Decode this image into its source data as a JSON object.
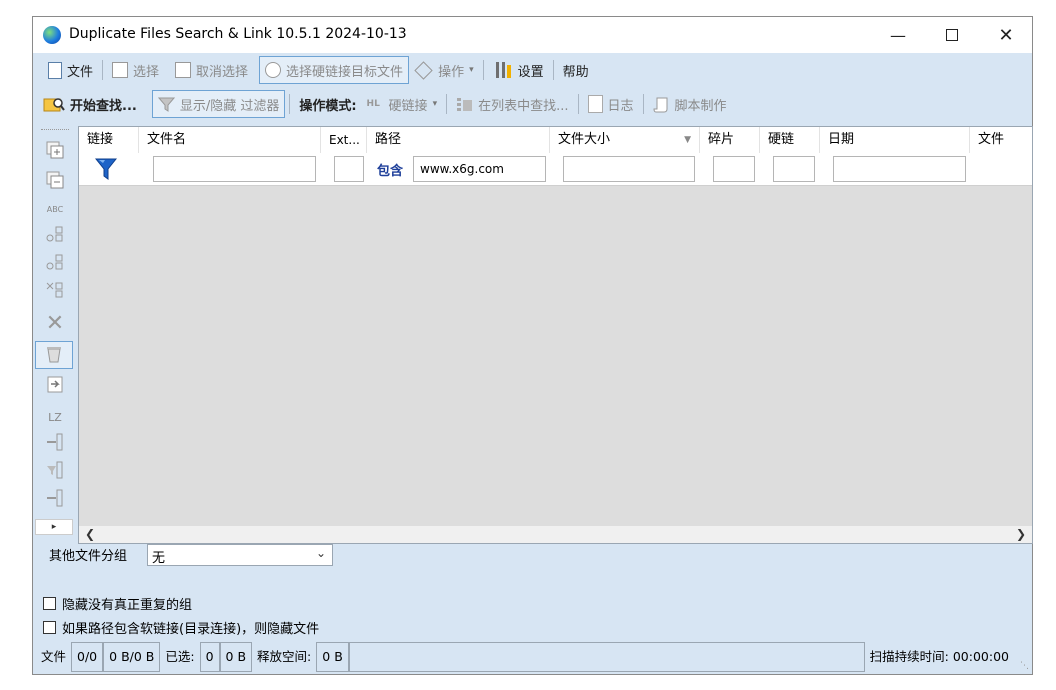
{
  "window": {
    "title": "Duplicate Files Search & Link 10.5.1 2024-10-13"
  },
  "toolbar1": {
    "file": "文件",
    "select": "选择",
    "deselect": "取消选择",
    "select_hardlink_target": "选择硬链接目标文件",
    "operation": "操作",
    "settings": "设置",
    "help": "帮助"
  },
  "toolbar2": {
    "start_search": "开始查找...",
    "toggle_filter": "显示/隐藏 过滤器",
    "mode_label": "操作模式:",
    "hardlink": "硬链接",
    "find_in_list": "在列表中查找...",
    "log": "日志",
    "script": "脚本制作"
  },
  "table": {
    "columns": [
      "链接",
      "文件名",
      "Ext...",
      "路径",
      "文件大小",
      "碎片",
      "硬链",
      "日期",
      "文件"
    ],
    "filter": {
      "path_mode": "包含",
      "path_value": "www.x6g.com"
    },
    "rows": []
  },
  "bottom": {
    "other_group_label": "其他文件分组",
    "other_group_value": "无",
    "hide_no_dup_label": "隐藏没有真正重复的组",
    "hide_softlink_label": "如果路径包含软链接(目录连接)，则隐藏文件"
  },
  "status": {
    "files_label": "文件",
    "files_count": "0/0",
    "bytes": "0 B/0 B",
    "selected_label": "已选:",
    "selected_count": "0",
    "selected_bytes": "0 B",
    "free_label": "释放空间:",
    "free_value": "0 B",
    "scan_time": "扫描持续时间: 00:00:00"
  },
  "left_sidebar": {
    "lz_label": "LZ",
    "abc_label": "ABC"
  },
  "colors": {
    "panel": "#d7e5f3",
    "grid_bg": "#dddddd",
    "accent": "#1e64c8"
  }
}
